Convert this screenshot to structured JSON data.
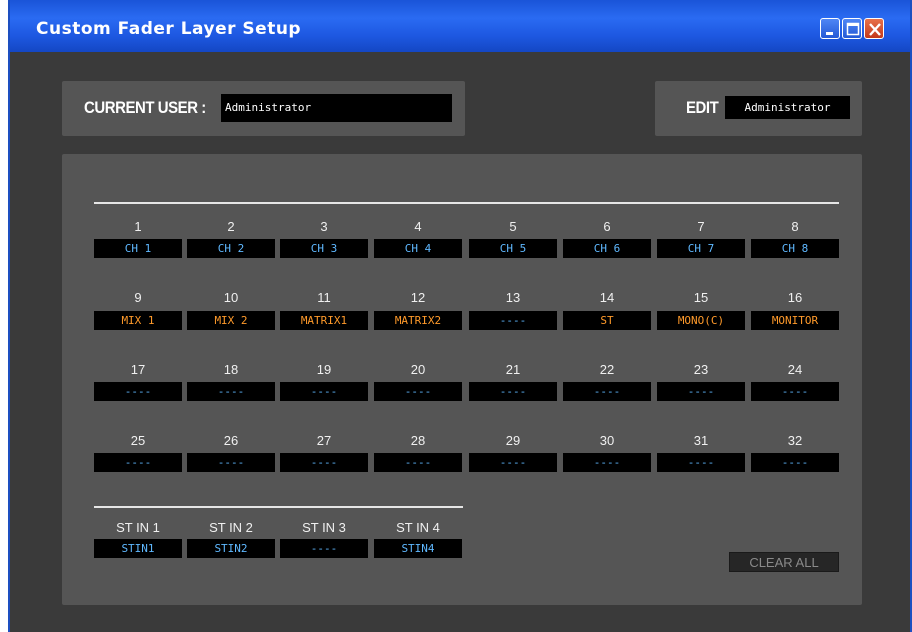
{
  "window": {
    "title": "Custom Fader Layer Setup",
    "buttons": {
      "minimize": "minimize-icon",
      "maximize": "maximize-icon",
      "close": "close-icon"
    }
  },
  "current_user": {
    "label": "CURRENT USER :",
    "value": "Administrator"
  },
  "edit": {
    "label": "EDIT",
    "value": "Administrator"
  },
  "faders": [
    {
      "num": "1",
      "assign": "CH 1",
      "color": "blue"
    },
    {
      "num": "2",
      "assign": "CH 2",
      "color": "blue"
    },
    {
      "num": "3",
      "assign": "CH 3",
      "color": "blue"
    },
    {
      "num": "4",
      "assign": "CH 4",
      "color": "blue"
    },
    {
      "num": "5",
      "assign": "CH 5",
      "color": "blue"
    },
    {
      "num": "6",
      "assign": "CH 6",
      "color": "blue"
    },
    {
      "num": "7",
      "assign": "CH 7",
      "color": "blue"
    },
    {
      "num": "8",
      "assign": "CH 8",
      "color": "blue"
    },
    {
      "num": "9",
      "assign": "MIX 1",
      "color": "orange"
    },
    {
      "num": "10",
      "assign": "MIX 2",
      "color": "orange"
    },
    {
      "num": "11",
      "assign": "MATRIX1",
      "color": "orange"
    },
    {
      "num": "12",
      "assign": "MATRIX2",
      "color": "orange"
    },
    {
      "num": "13",
      "assign": "----",
      "color": "blue"
    },
    {
      "num": "14",
      "assign": "ST",
      "color": "orange"
    },
    {
      "num": "15",
      "assign": "MONO(C)",
      "color": "orange"
    },
    {
      "num": "16",
      "assign": "MONITOR",
      "color": "orange"
    },
    {
      "num": "17",
      "assign": "----",
      "color": "blue"
    },
    {
      "num": "18",
      "assign": "----",
      "color": "blue"
    },
    {
      "num": "19",
      "assign": "----",
      "color": "blue"
    },
    {
      "num": "20",
      "assign": "----",
      "color": "blue"
    },
    {
      "num": "21",
      "assign": "----",
      "color": "blue"
    },
    {
      "num": "22",
      "assign": "----",
      "color": "blue"
    },
    {
      "num": "23",
      "assign": "----",
      "color": "blue"
    },
    {
      "num": "24",
      "assign": "----",
      "color": "blue"
    },
    {
      "num": "25",
      "assign": "----",
      "color": "blue"
    },
    {
      "num": "26",
      "assign": "----",
      "color": "blue"
    },
    {
      "num": "27",
      "assign": "----",
      "color": "blue"
    },
    {
      "num": "28",
      "assign": "----",
      "color": "blue"
    },
    {
      "num": "29",
      "assign": "----",
      "color": "blue"
    },
    {
      "num": "30",
      "assign": "----",
      "color": "blue"
    },
    {
      "num": "31",
      "assign": "----",
      "color": "blue"
    },
    {
      "num": "32",
      "assign": "----",
      "color": "blue"
    }
  ],
  "st_in": [
    {
      "num": "ST IN 1",
      "assign": "STIN1",
      "color": "blue"
    },
    {
      "num": "ST IN 2",
      "assign": "STIN2",
      "color": "blue"
    },
    {
      "num": "ST IN 3",
      "assign": "----",
      "color": "blue"
    },
    {
      "num": "ST IN 4",
      "assign": "STIN4",
      "color": "blue"
    }
  ],
  "clear_all_label": "CLEAR ALL",
  "colors": {
    "blue": "#5fb8ff",
    "orange": "#ff9a2a",
    "titlebar": "#1d57e0",
    "background": "#3a3a3a",
    "panel": "#555555"
  }
}
